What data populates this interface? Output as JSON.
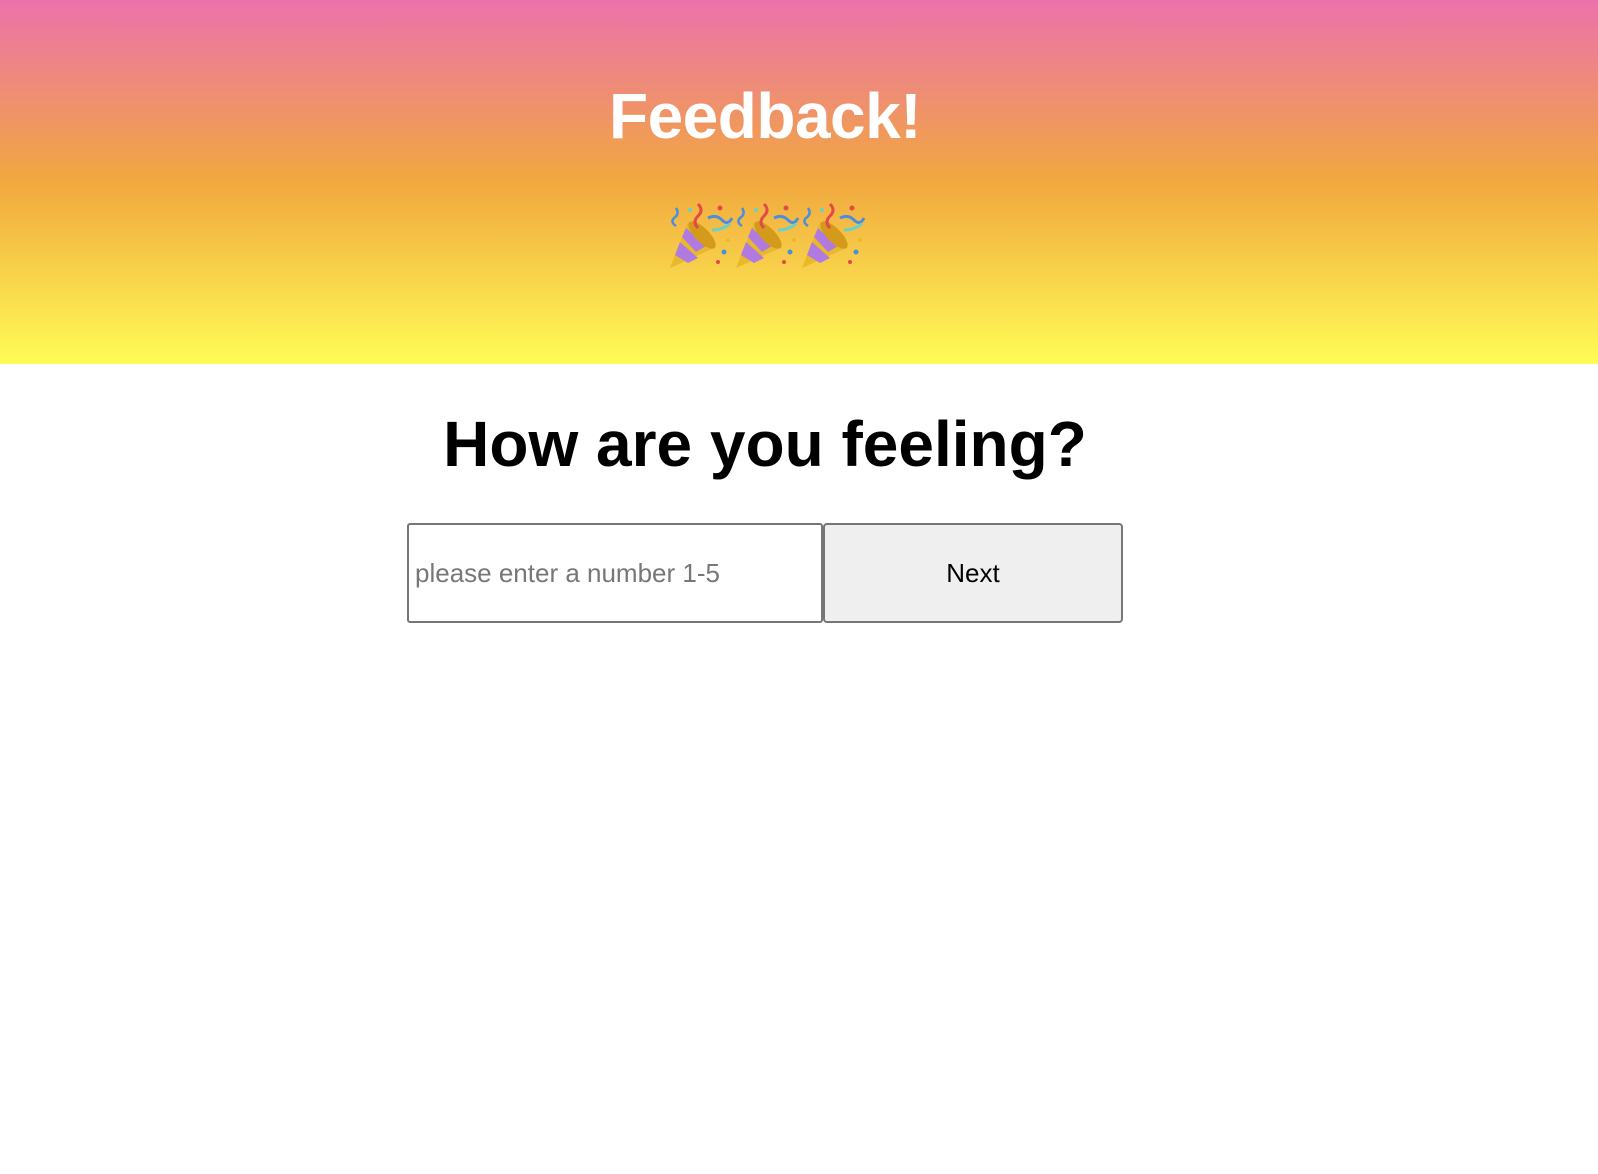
{
  "header": {
    "title": "Feedback!",
    "gradient_colors": [
      "#ec72ac",
      "#f1a83e",
      "#fffc56"
    ],
    "decoration": {
      "icon": "party-popper-icon",
      "count": 3
    }
  },
  "main": {
    "question": "How are you feeling?",
    "input": {
      "value": "",
      "placeholder": "please enter a number 1-5"
    },
    "next_button": {
      "label": "Next"
    }
  }
}
